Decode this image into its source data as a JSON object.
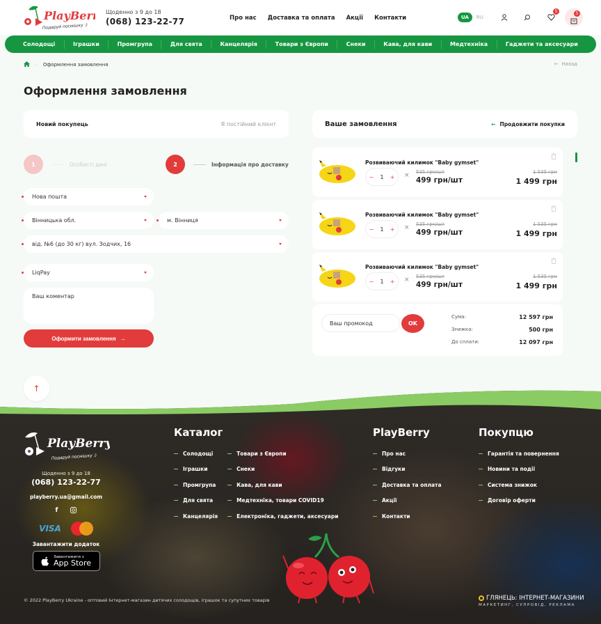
{
  "header": {
    "logo_text": "PlayBerry",
    "logo_tagline": "Подаруй посмішку :)",
    "hours": "Щоденно з 9 до 18",
    "phone": "(068) 123-22-77",
    "top_nav": [
      "Про нас",
      "Доставка та оплата",
      "Акції",
      "Контакти"
    ],
    "lang_active": "UA",
    "lang_other": "RU",
    "wishlist_count": "5",
    "cart_count": "5"
  },
  "main_nav": [
    "Солодощі",
    "Іграшки",
    "Промгрупа",
    "Для свята",
    "Канцелярія",
    "Товари з Європи",
    "Снеки",
    "Кава, для кави",
    "Медтехніка",
    "Гаджети та аксесуари"
  ],
  "breadcrumb": {
    "current": "Оформлення замовлення",
    "back": "Назад"
  },
  "page_title": "Оформлення замовлення",
  "customer_tabs": {
    "active": "Новий покупець",
    "inactive": "Я постійний клієнт"
  },
  "steps": [
    {
      "num": "1",
      "label": "Особисті дані",
      "active": false
    },
    {
      "num": "2",
      "label": "Інформація про доставку",
      "active": true
    }
  ],
  "form": {
    "delivery": "Нова пошта",
    "region": "Вінницька обл.",
    "city": "м. Вінниця",
    "branch": "від. №6 (до 30 кг) вул. Зодчих, 16",
    "payment": "LiqPay",
    "comment_placeholder": "Ваш коментар",
    "submit": "Оформити замовлення"
  },
  "order": {
    "title": "Ваше замовлення",
    "continue": "Продовжити покупки",
    "items": [
      {
        "name": "Розвиваючий килимок \"Baby gymset\"",
        "qty": "1",
        "old_price": "535 грн/шт",
        "price": "499 грн/шт",
        "old_total": "1 535 грн",
        "total": "1 499 грн"
      },
      {
        "name": "Розвиваючий килимок \"Baby gymset\"",
        "qty": "1",
        "old_price": "535 грн/шт",
        "price": "499 грн/шт",
        "old_total": "1 535 грн",
        "total": "1 499 грн"
      },
      {
        "name": "Розвиваючий килимок \"Baby gymset\"",
        "qty": "1",
        "old_price": "535 грн/шт",
        "price": "499 грн/шт",
        "old_total": "1 535 грн",
        "total": "1 499 грн"
      }
    ],
    "promo_placeholder": "Ваш промокод",
    "promo_button": "OK",
    "summary": [
      {
        "label": "Сума:",
        "value": "12 597 грн"
      },
      {
        "label": "Знижка:",
        "value": "500 грн"
      },
      {
        "label": "До сплати:",
        "value": "12 097 грн"
      }
    ]
  },
  "footer": {
    "hours": "Щоденно з 9 до 18",
    "phone": "(068) 123-22-77",
    "email": "playberry.ua@gmail.com",
    "download_app": "Завантажити додаток",
    "appstore_small": "Завантажити з",
    "appstore_big": "App Store",
    "visa": "VISA",
    "mastercard": "MasterCard",
    "catalog_title": "Каталог",
    "catalog_col1": [
      "Солодощі",
      "Іграшки",
      "Промгрупа",
      "Для свята",
      "Канцелярія"
    ],
    "catalog_col2": [
      "Товари з Європи",
      "Снеки",
      "Кава, для кави",
      "Медтехніка, товари COVID19",
      "Електроніка, гаджети, аксесуари"
    ],
    "brand_title": "PlayBerry",
    "brand_links": [
      "Про нас",
      "Відгуки",
      "Доставка та оплата",
      "Акції",
      "Контакти"
    ],
    "buyer_title": "Покупцю",
    "buyer_links": [
      "Гарантія та повернення",
      "Новини та події",
      "Система знижок",
      "Договір оферти"
    ],
    "copyright": "© 2022 PlayBerry Ukraine - оптовий Інтернет-магазин дитячих солодощів, іграшок та супутних товарів",
    "dev_title": "ГЛЯНЕЦЬ: ІНТЕРНЕТ-МАГАЗИНИ",
    "dev_sub": "МАРКЕТИНГ, СУПРОВІД, РЕКЛАМА"
  }
}
